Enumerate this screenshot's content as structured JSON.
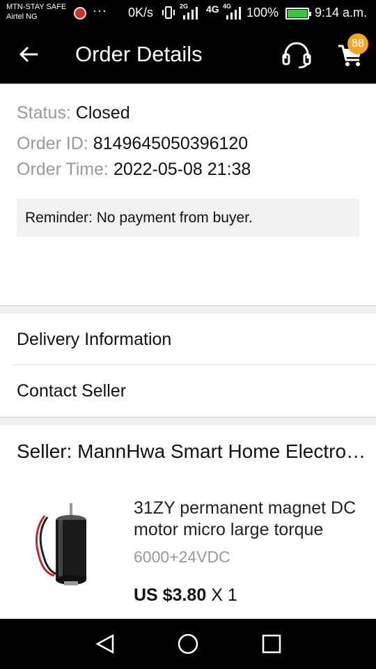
{
  "status_bar": {
    "carrier_primary": "MTN-STAY SAFE",
    "carrier_secondary": "Airtel NG",
    "overflow": "···",
    "net_speed": "0K/s",
    "net_type_1": "2G",
    "net_type_2": "4G",
    "net_type_3": "4G",
    "battery": "100%",
    "time": "9:14 a.m."
  },
  "app_bar": {
    "title": "Order Details",
    "back_icon": "arrow-left-icon",
    "support_icon": "headset-icon",
    "cart_icon": "cart-icon",
    "cart_count": "88"
  },
  "order": {
    "status_label": "Status:",
    "status_value": "Closed",
    "id_label": "Order ID:",
    "id_value": "8149645050396120",
    "time_label": "Order Time:",
    "time_value": "2022-05-08 21:38",
    "reminder": "Reminder: No payment from buyer."
  },
  "menu": {
    "delivery": "Delivery Information",
    "contact": "Contact Seller"
  },
  "seller": {
    "label": "Seller:",
    "name": "MannHwa Smart Home Electronics"
  },
  "product": {
    "title": "31ZY permanent magnet DC motor micro large torque",
    "variant": "6000+24VDC",
    "price": "US $3.80",
    "quantity": "X 1"
  },
  "colors": {
    "badge": "#f5a623",
    "battery": "#3cc43c"
  }
}
